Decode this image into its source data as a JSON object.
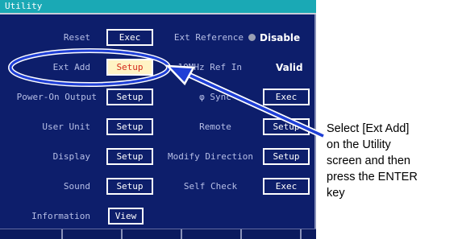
{
  "window": {
    "title": "Utility"
  },
  "left_rows": [
    {
      "label": "Reset",
      "button": "Exec"
    },
    {
      "label": "Ext Add",
      "button": "Setup",
      "selected": true
    },
    {
      "label": "Power-On Output",
      "button": "Setup"
    },
    {
      "label": "User Unit",
      "button": "Setup"
    },
    {
      "label": "Display",
      "button": "Setup"
    },
    {
      "label": "Sound",
      "button": "Setup"
    },
    {
      "label": "Information",
      "button": "View"
    }
  ],
  "right_rows": {
    "ext_reference": {
      "label": "Ext Reference",
      "value": "Disable"
    },
    "ref_in": {
      "label": "10MHz Ref In",
      "value": "Valid"
    },
    "phase_sync": {
      "label": "φ Sync",
      "button": "Exec"
    },
    "remote": {
      "label": "Remote",
      "button": "Setup"
    },
    "modify_direction": {
      "label": "Modify Direction",
      "button": "Setup"
    },
    "self_check": {
      "label": "Self Check",
      "button": "Exec"
    }
  },
  "annotation": {
    "lines": [
      "Select [Ext Add]",
      "on the Utility",
      "screen and then",
      "press the ENTER",
      "key"
    ]
  },
  "colors": {
    "screen_bg": "#0d1e6b",
    "title_bar": "#1aa9b5",
    "selected_button_bg": "#fff3c4",
    "selected_button_text": "#d42a1c",
    "highlight_ring": "#1f3fd6"
  }
}
